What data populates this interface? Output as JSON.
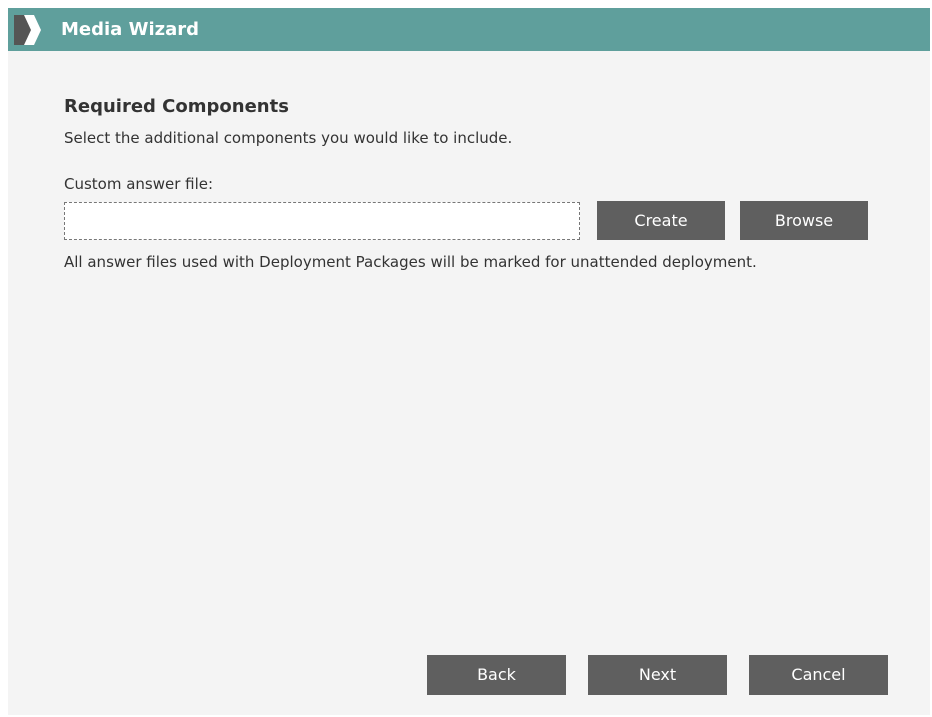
{
  "window": {
    "title": "Media Wizard",
    "title_icon": "chevron-right-icon",
    "header_color": "#5f9f9c",
    "button_color": "#5f5f5f"
  },
  "page": {
    "heading": "Required Components",
    "subheading": "Select the additional components you would like to include."
  },
  "answer_file": {
    "label": "Custom answer file:",
    "value": "",
    "placeholder": "",
    "create_label": "Create",
    "browse_label": "Browse",
    "note": "All answer files used with Deployment Packages will be marked for unattended deployment."
  },
  "footer": {
    "back_label": "Back",
    "next_label": "Next",
    "cancel_label": "Cancel"
  }
}
